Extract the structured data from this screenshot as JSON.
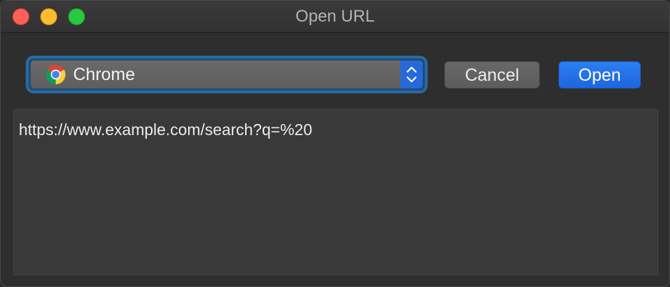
{
  "window": {
    "title": "Open URL"
  },
  "browser_select": {
    "selected": "Chrome",
    "icon": "chrome-icon"
  },
  "buttons": {
    "cancel_label": "Cancel",
    "open_label": "Open"
  },
  "url_field": {
    "value": "https://www.example.com/search?q=%20"
  },
  "colors": {
    "accent": "#2769d8",
    "focus_ring": "#2a6aa0",
    "close": "#ff5f57",
    "minimize": "#febc2e",
    "zoom": "#28c840"
  }
}
